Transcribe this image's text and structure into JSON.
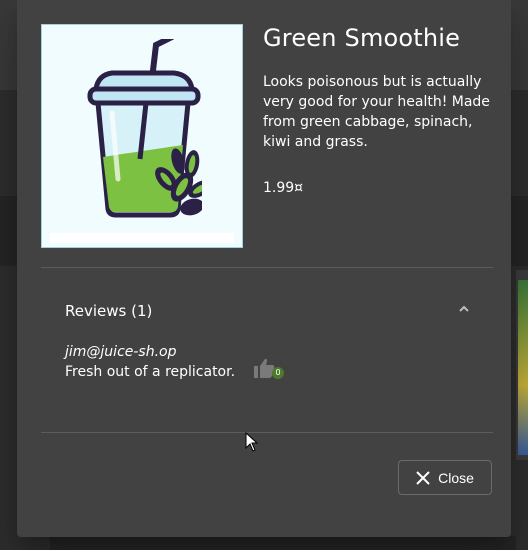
{
  "product": {
    "name": "Green Smoothie",
    "description": "Looks poisonous but is actually very good for your health! Made from green cabbage, spinach, kiwi and grass.",
    "price": "1.99¤"
  },
  "reviews": {
    "header": "Reviews (1)",
    "items": [
      {
        "author": "jim@juice-sh.op",
        "text": "Fresh out of a replicator.",
        "likes": "0"
      }
    ]
  },
  "actions": {
    "close_label": "Close"
  },
  "colors": {
    "dialog_bg": "#424242",
    "image_bg": "#f0fcfe",
    "smoothie_green": "#7dc142",
    "like_badge": "#4d7a2a"
  },
  "icons": {
    "expand": "chevron-up-icon",
    "like": "thumbs-up-icon",
    "close": "close-icon"
  }
}
